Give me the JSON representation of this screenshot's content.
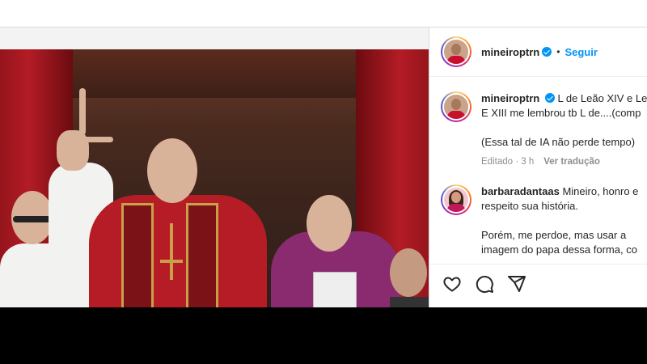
{
  "post": {
    "author": "mineiroptrn",
    "follow_label": "Seguir",
    "separator": "•",
    "caption_lines": [
      "L de Leão XIV e Le",
      "E XIII me lembrou tb L de....(comp",
      "(Essa tal de IA não perde tempo)"
    ],
    "caption_meta": {
      "edited": "Editado · 3 h",
      "translate": "Ver tradução"
    }
  },
  "comment": {
    "author": "barbaradantaas",
    "lines": [
      "Mineiro, honro e",
      "respeito sua história.",
      "Porém, me perdoe, mas usar a",
      "imagem do papa dessa forma, co"
    ]
  },
  "icons": [
    "heart-icon",
    "comment-icon",
    "share-icon",
    "verified-badge-icon"
  ],
  "colors": {
    "accent": "#0095f6",
    "text": "#262626",
    "muted": "#8e8e8e"
  }
}
